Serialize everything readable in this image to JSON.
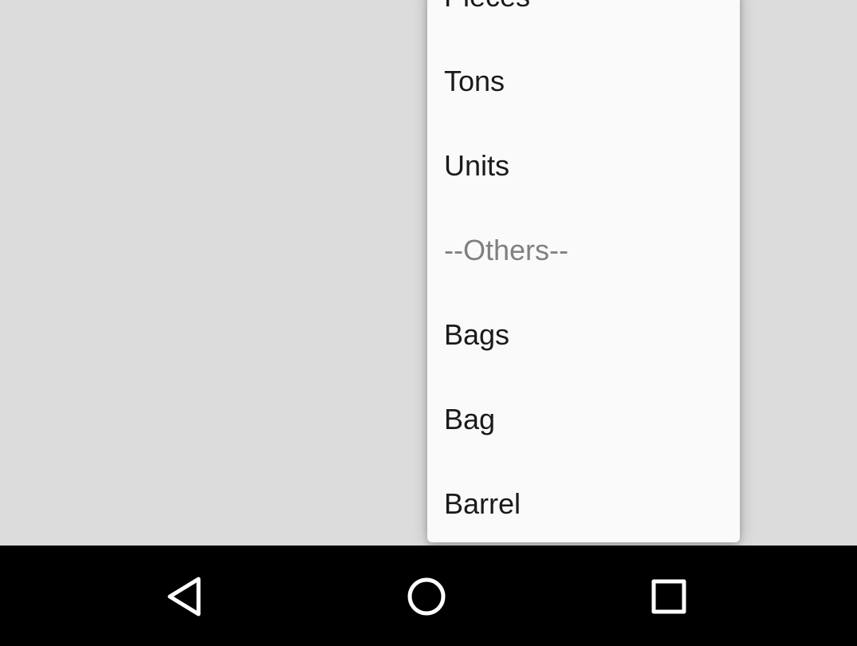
{
  "dropdown": {
    "items": [
      {
        "label": "Pieces",
        "enabled": true
      },
      {
        "label": "Tons",
        "enabled": true
      },
      {
        "label": "Units",
        "enabled": true
      },
      {
        "label": "--Others--",
        "enabled": false
      },
      {
        "label": "Bags",
        "enabled": true
      },
      {
        "label": "Bag",
        "enabled": true
      },
      {
        "label": "Barrel",
        "enabled": true
      }
    ]
  },
  "navigation_bar": {
    "back_icon": "back-triangle-icon",
    "home_icon": "home-circle-icon",
    "recents_icon": "recents-square-icon"
  },
  "colors": {
    "background": "#dcdcdc",
    "dropdown_background": "#fafafa",
    "item_text": "#1a1a1a",
    "disabled_text": "#808080",
    "nav_bar": "#000000",
    "nav_icon": "#ffffff"
  }
}
